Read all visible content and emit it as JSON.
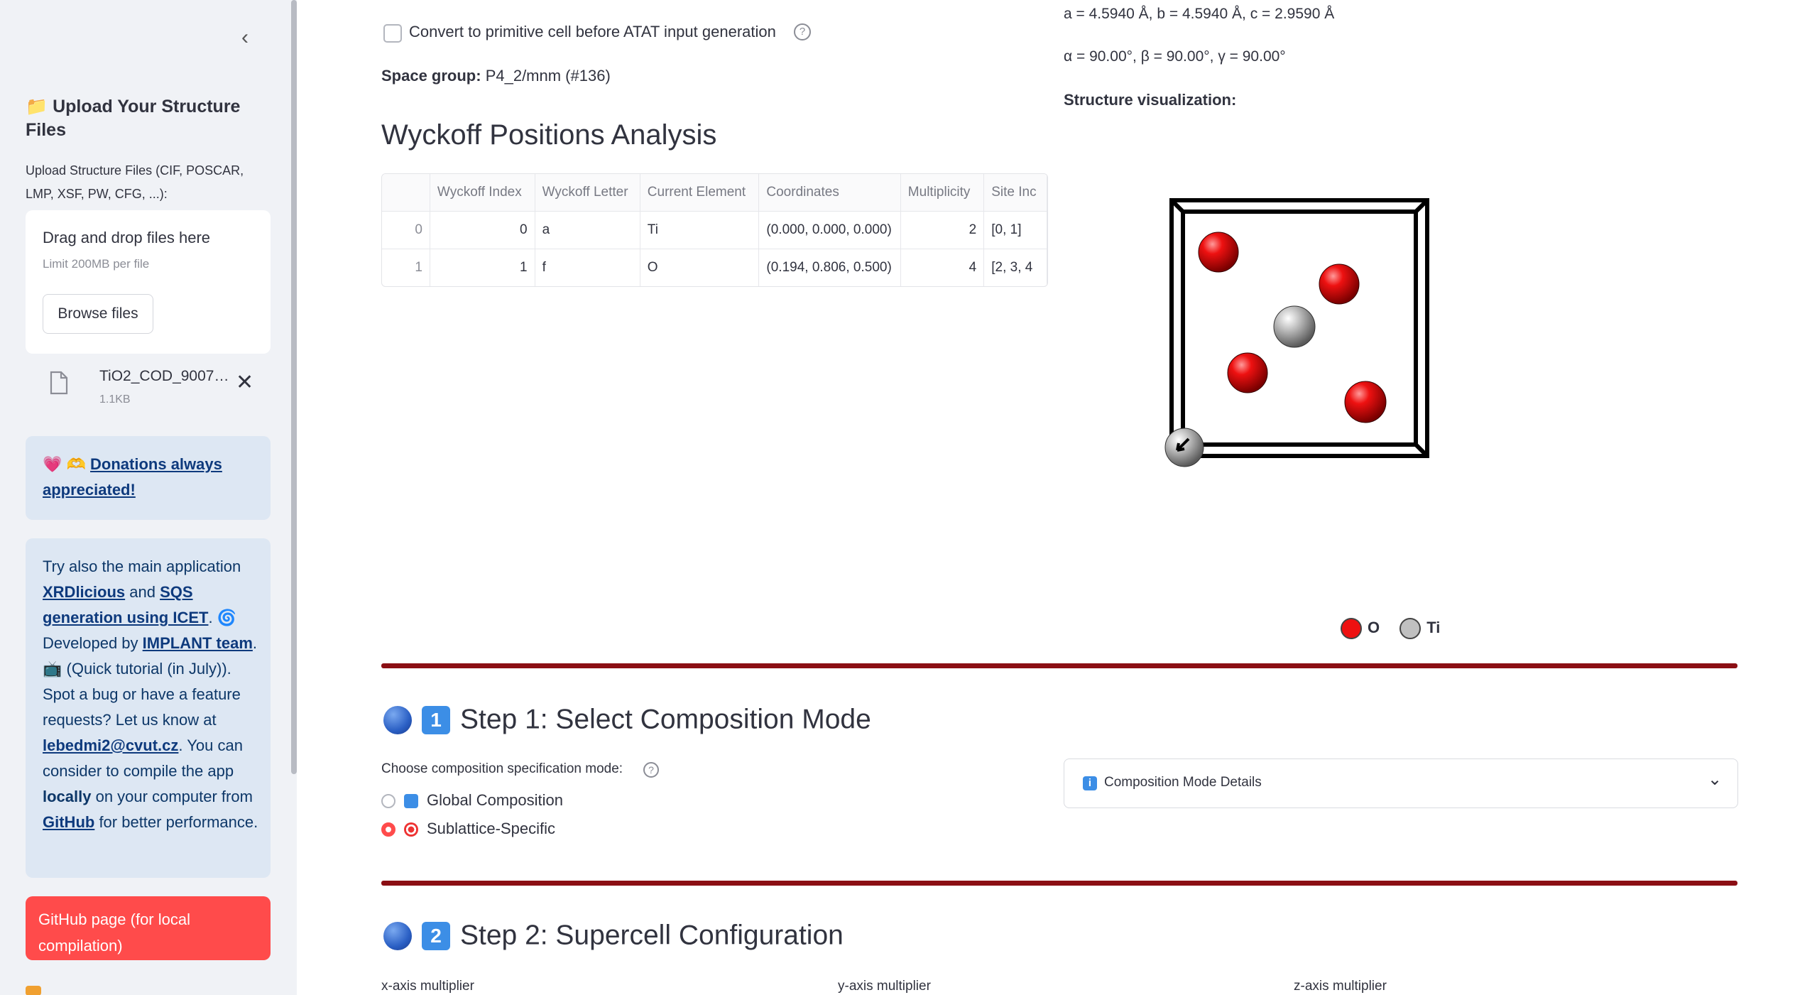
{
  "sidebar": {
    "collapse_icon": "‹",
    "upload_title": "📁 Upload Your Structure Files",
    "upload_label": "Upload Structure Files (CIF, POSCAR, LMP, XSF, PW, CFG, ...):",
    "drop_text": "Drag and drop files here",
    "drop_limit": "Limit 200MB per file",
    "browse_label": "Browse files",
    "file_name": "TiO2_COD_9007…",
    "file_size": "1.1KB",
    "file_close": "✕",
    "donate_emoji": "💗 🫶",
    "donate_link": "Donations always appreciated!",
    "info": {
      "t1": "Try also the main application ",
      "link_xrd": "XRDlicious",
      "t2": " and ",
      "link_sqs": "SQS generation using ICET",
      "t3": ". 🌀 Developed by ",
      "link_team": "IMPLANT team",
      "t4": ". 📺 (Quick tutorial (in July)). Spot a bug or have a feature requests? Let us know at ",
      "link_email": "lebedmi2@cvut.cz",
      "t5": ". You can consider to compile the app ",
      "bold_locally": "locally",
      "t6": " on your computer from ",
      "link_github": "GitHub",
      "t7": " for better performance."
    },
    "github_button": "GitHub page (for local compilation)"
  },
  "main": {
    "primitive_checkbox_label": "Convert to primitive cell before ATAT input generation",
    "help_glyph": "?",
    "space_group_key": "Space group:",
    "space_group_value": " P4_2/mnm (#136)",
    "wyckoff_title": "Wyckoff Positions Analysis",
    "table": {
      "headers": [
        "",
        "Wyckoff Index",
        "Wyckoff Letter",
        "Current Element",
        "Coordinates",
        "Multiplicity",
        "Site Inc"
      ],
      "rows": [
        [
          "0",
          "0",
          "a",
          "Ti",
          "(0.000, 0.000, 0.000)",
          "2",
          "[0, 1]"
        ],
        [
          "1",
          "1",
          "f",
          "O",
          "(0.194, 0.806, 0.500)",
          "4",
          "[2, 3, 4"
        ]
      ]
    },
    "lattice_abc": "a = 4.5940 Å, b = 4.5940 Å, c = 2.9590 Å",
    "lattice_angles": "α = 90.00°, β = 90.00°, γ = 90.00°",
    "viz_label": "Structure visualization:",
    "legend": [
      {
        "label": "O",
        "color": "#ee1111"
      },
      {
        "label": "Ti",
        "color": "#c0c0c0"
      }
    ],
    "step1_number": "1",
    "step1_title": "Step 1: Select Composition Mode",
    "mode_label": "Choose composition specification mode:",
    "radio_global": "Global Composition",
    "radio_sublattice": "Sublattice-Specific",
    "expander_icon": "i",
    "expander_label": "Composition Mode Details",
    "expander_chevron": "⌄",
    "step2_number": "2",
    "step2_title": "Step 2: Supercell Configuration",
    "x_label": "x-axis multiplier",
    "y_label": "y-axis multiplier",
    "z_label": "z-axis multiplier"
  },
  "colors": {
    "accent": "#ff4b4b",
    "divider": "#8b0f14",
    "sidebar_bg": "#f0f2f6",
    "info_bg": "#dde7f3"
  }
}
